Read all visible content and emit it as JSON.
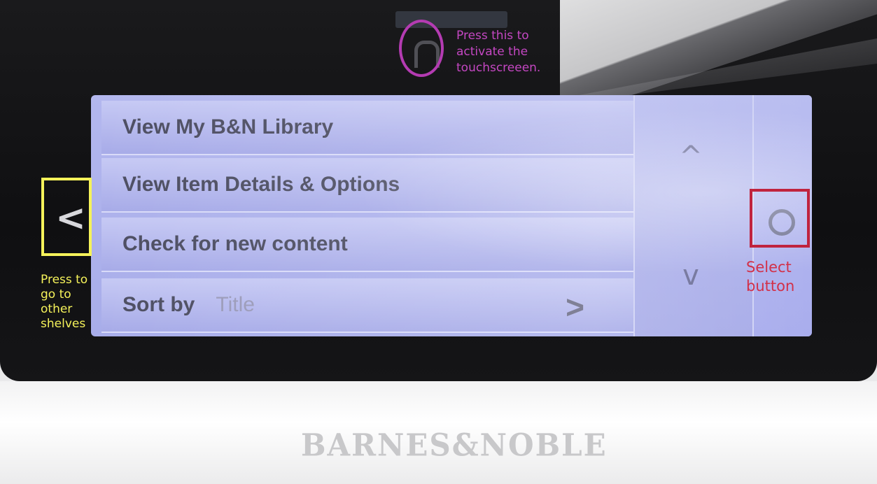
{
  "screen": {
    "menu_items": [
      {
        "label": "View My B&N Library"
      },
      {
        "label": "View Item Details & Options"
      },
      {
        "label": "Check for new content"
      },
      {
        "label": "Sort by",
        "value": "Title"
      }
    ],
    "scroll_up_symbol": "^",
    "scroll_down_symbol": "v",
    "submenu_arrow_symbol": ">"
  },
  "device": {
    "brand": "BARNES&NOBLE",
    "back_button_symbol": "<",
    "home_button_icon": "home-arch-icon",
    "select_button_icon": "select-circle-icon"
  },
  "annotations": {
    "home": {
      "text": "Press this to activate the touchscreeen.",
      "color": "#b43bb2"
    },
    "back": {
      "text": "Press to go to other shelves",
      "color": "#f5f25a"
    },
    "select": {
      "text": "Select button",
      "color": "#c0233e"
    }
  }
}
